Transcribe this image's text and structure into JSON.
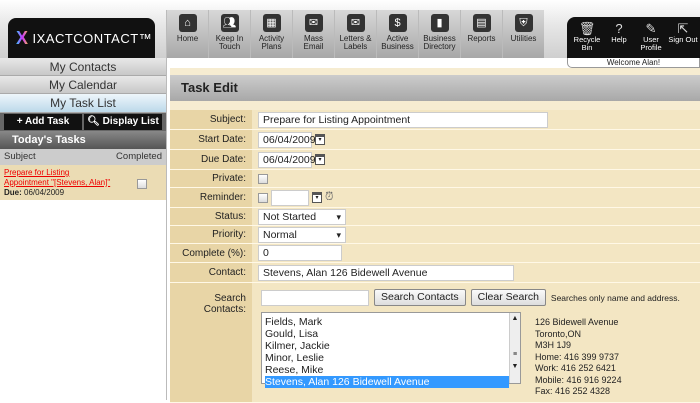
{
  "brand": {
    "logo": "IXACTCONTACT™"
  },
  "nav": [
    {
      "label": "Home",
      "icon": "home-icon"
    },
    {
      "label": "Keep In Touch",
      "icon": "people-icon"
    },
    {
      "label": "Activity Plans",
      "icon": "calendar-icon"
    },
    {
      "label": "Mass Email",
      "icon": "envelope-icon"
    },
    {
      "label": "Letters & Labels",
      "icon": "letters-icon"
    },
    {
      "label": "Active Business",
      "icon": "sign-icon"
    },
    {
      "label": "Business Directory",
      "icon": "book-icon"
    },
    {
      "label": "Reports",
      "icon": "reports-icon"
    },
    {
      "label": "Utilities",
      "icon": "shield-icon"
    }
  ],
  "util": [
    {
      "label": "Recycle Bin",
      "icon": "trash-icon"
    },
    {
      "label": "Help",
      "icon": "help-icon"
    },
    {
      "label": "User Profile",
      "icon": "wrench-icon"
    },
    {
      "label": "Sign Out",
      "icon": "sign-out-icon"
    }
  ],
  "welcome": "Welcome Alan!",
  "sidebar": {
    "menu": [
      "My Contacts",
      "My Calendar",
      "My Task List"
    ],
    "add_task": "+ Add Task",
    "display_list": "Display List",
    "todays_tasks": "Today's Tasks",
    "col_subject": "Subject",
    "col_completed": "Completed",
    "task": {
      "title": "Prepare for Listing Appointment \"[Stevens, Alan]\"",
      "due_label": "Due:",
      "due": "06/04/2009"
    }
  },
  "form": {
    "title": "Task Edit",
    "subject_label": "Subject:",
    "subject": "Prepare for Listing Appointment",
    "start_label": "Start Date:",
    "start": "06/04/2009",
    "due_label": "Due Date:",
    "due": "06/04/2009",
    "private_label": "Private:",
    "reminder_label": "Reminder:",
    "status_label": "Status:",
    "status": "Not Started",
    "priority_label": "Priority:",
    "priority": "Normal",
    "complete_label": "Complete (%):",
    "complete": "0",
    "contact_label": "Contact:",
    "contact": "Stevens, Alan 126 Bidewell Avenue",
    "search_label": "Search Contacts:",
    "search_button": "Search Contacts",
    "clear_button": "Clear Search",
    "search_hint": "Searches only name and address.",
    "contacts": [
      "Fields, Mark",
      "Gould, Lisa",
      "Kilmer, Jackie",
      "Minor, Leslie",
      "Reese, Mike",
      "Stevens, Alan 126 Bidewell Avenue"
    ],
    "selected_contact": "Stevens, Alan 126 Bidewell Avenue",
    "address": [
      "126 Bidewell Avenue",
      "Toronto,ON",
      "M3H 1J9",
      "Home: 416 399 9737",
      "Work: 416 252 6421",
      "Mobile: 416 916 9224",
      "Fax: 416 252 4328"
    ]
  }
}
